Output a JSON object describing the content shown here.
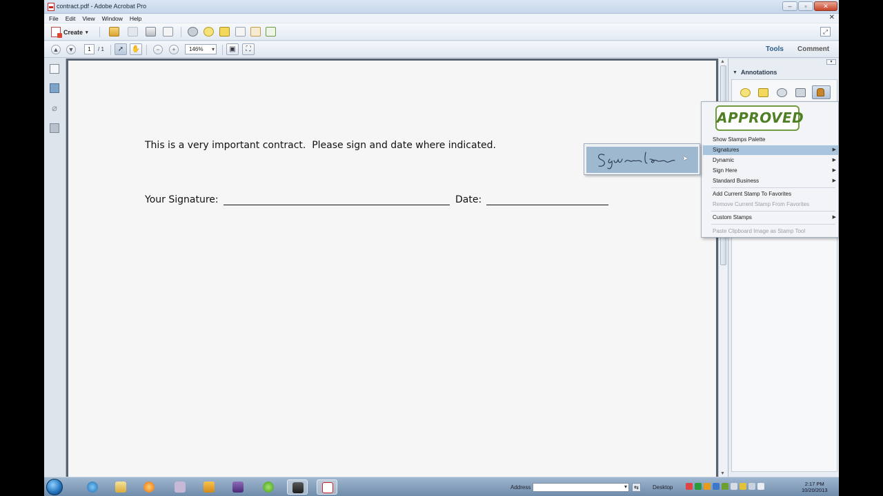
{
  "window": {
    "title": "contract.pdf - Adobe Acrobat Pro"
  },
  "menu": [
    "File",
    "Edit",
    "View",
    "Window",
    "Help"
  ],
  "toolbar": {
    "create_label": "Create",
    "icons": [
      "open-icon",
      "save-icon",
      "print-icon",
      "email-icon",
      "settings-icon",
      "comment-icon",
      "highlight-icon",
      "file-icon",
      "export-icon",
      "review-icon",
      "expand-icon"
    ]
  },
  "navigation": {
    "page_number": "1",
    "page_total": "/ 1",
    "zoom": "146%"
  },
  "panels": {
    "tools_label": "Tools",
    "comment_label": "Comment",
    "annotations_label": "Annotations"
  },
  "document": {
    "line1": "This is a very important contract.  Please sign and date where indicated.",
    "signature_label": "Your Signature:",
    "date_label": "Date:"
  },
  "stamp_menu": {
    "preview_stamp": "APPROVED",
    "items": [
      {
        "label": "Show Stamps Palette",
        "submenu": false,
        "highlighted": false,
        "disabled": false
      },
      {
        "label": "Signatures",
        "submenu": true,
        "highlighted": true,
        "disabled": false
      },
      {
        "label": "Dynamic",
        "submenu": true,
        "highlighted": false,
        "disabled": false
      },
      {
        "label": "Sign Here",
        "submenu": true,
        "highlighted": false,
        "disabled": false
      },
      {
        "label": "Standard Business",
        "submenu": true,
        "highlighted": false,
        "disabled": false
      },
      {
        "label": "Add Current Stamp To Favorites",
        "submenu": false,
        "highlighted": false,
        "disabled": false
      },
      {
        "label": "Remove Current Stamp From Favorites",
        "submenu": false,
        "highlighted": false,
        "disabled": true
      },
      {
        "label": "Custom Stamps",
        "submenu": true,
        "highlighted": false,
        "disabled": false
      },
      {
        "label": "Paste Clipboard Image as Stamp Tool",
        "submenu": false,
        "highlighted": false,
        "disabled": true
      }
    ]
  },
  "taskbar": {
    "address_label": "Address",
    "desktop_label": "Desktop",
    "clock_time": "2:17 PM",
    "clock_date": "10/20/2013"
  },
  "colors": {
    "stamp_green": "#4e7f23",
    "menu_highlight": "#a9c4dd",
    "tools_link": "#2a5a8a"
  }
}
